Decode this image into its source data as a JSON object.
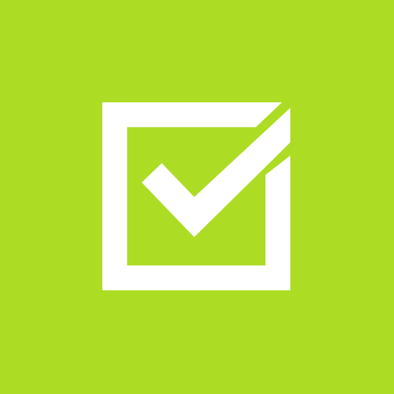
{
  "app_icon": {
    "icon": "checkbox-checked-icon",
    "background_color": "#ADDC24",
    "foreground_color": "#FFFFFF",
    "checked": true
  }
}
